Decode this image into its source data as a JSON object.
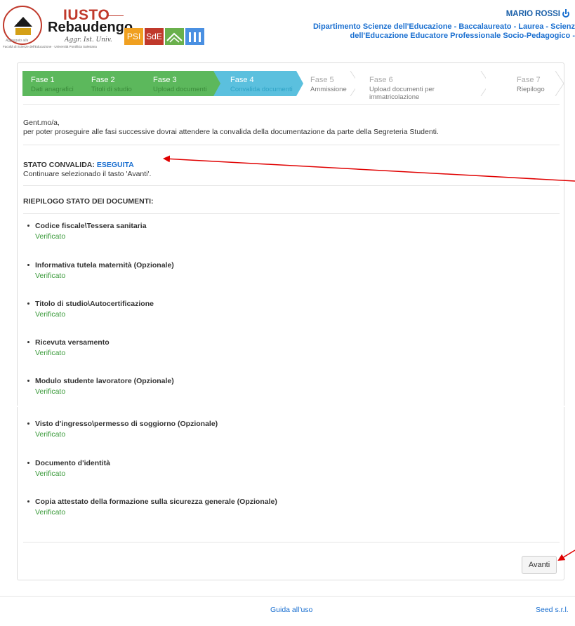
{
  "header": {
    "logo": {
      "brand_top": "IUSTO",
      "brand_main": "Rebaudengo",
      "signature": "Aggr. Ist. Univ.",
      "tagline_small": "Aggregato alla",
      "faculty": "Facoltà di Scienze dell'Educazione · Università Pontificia Salesiana",
      "badges": [
        "PSI",
        "SdE"
      ]
    },
    "user_name": "MARIO ROSSI",
    "department_line1": "Dipartimento Scienze dell'Educazione - Baccalaureato - Laurea - Scienz",
    "department_line2": "dell'Educazione Educatore Professionale Socio-Pedagogico -"
  },
  "steps": [
    {
      "title": "Fase 1",
      "subtitle": "Dati anagrafici",
      "state": "done"
    },
    {
      "title": "Fase 2",
      "subtitle": "Titoli di studio",
      "state": "done"
    },
    {
      "title": "Fase 3",
      "subtitle": "Upload documenti",
      "state": "done"
    },
    {
      "title": "Fase 4",
      "subtitle": "Convalida documenti",
      "state": "current"
    },
    {
      "title": "Fase 5",
      "subtitle": "Ammissione",
      "state": "future"
    },
    {
      "title": "Fase 6",
      "subtitle": "Upload documenti per immatricolazione",
      "state": "future"
    },
    {
      "title": "Fase 7",
      "subtitle": "Riepilogo",
      "state": "future"
    }
  ],
  "intro": {
    "greeting": "Gent.mo/a,",
    "message": "per poter proseguire alle fasi successive dovrai attendere la convalida della documentazione da parte della Segreteria Studenti."
  },
  "stato": {
    "label": "STATO CONVALIDA: ",
    "value": "ESEGUITA",
    "hint": "Continuare selezionado il tasto 'Avanti'."
  },
  "riepilogo_title": "RIEPILOGO STATO DEI DOCUMENTI:",
  "documents": [
    {
      "name": "Codice fiscale\\Tessera sanitaria",
      "status": "Verificato"
    },
    {
      "name": "Informativa tutela maternità (Opzionale)",
      "status": "Verificato"
    },
    {
      "name": "Titolo di studio\\Autocertificazione",
      "status": "Verificato"
    },
    {
      "name": "Ricevuta versamento",
      "status": "Verificato"
    },
    {
      "name": "Modulo studente lavoratore (Opzionale)",
      "status": "Verificato"
    },
    {
      "name": "Visto d'ingresso\\permesso di soggiorno (Opzionale)",
      "status": "Verificato"
    },
    {
      "name": "Documento d'identità",
      "status": "Verificato"
    },
    {
      "name": "Copia attestato della formazione sulla sicurezza generale (Opzionale)",
      "status": "Verificato"
    }
  ],
  "next_button": "Avanti",
  "footer": {
    "guide": "Guida all'uso",
    "company": "Seed s.r.l."
  },
  "colors": {
    "done": "#5cb85c",
    "current": "#5bc0de",
    "link": "#1a6fd0",
    "verified": "#3a9a3a",
    "annotation": "#e00000"
  }
}
